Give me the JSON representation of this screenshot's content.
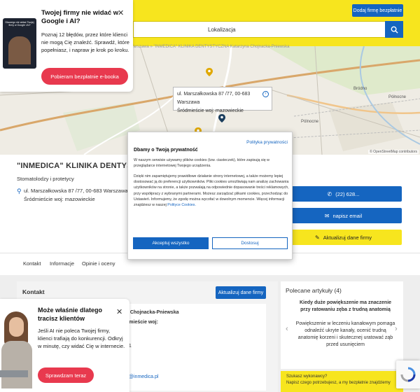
{
  "header": {
    "add_company_label": "Dodaj firmę bezpłatnie",
    "search_location_label": "Lokalizacja"
  },
  "map": {
    "breadcrumb": "» Warszawa » \"INMEDICA\" KLINIKA DENTYSTYCZNA Katarzyna Chojnacka-Pniewska",
    "popup_line1": "ul. Marszałkowska 87 /77, 00-683 Warszawa",
    "popup_line2": "Śródmieście woj: mazowieckie",
    "credit": "© OpenStreetMap contributors",
    "labels": [
      "Bródno",
      "Północne",
      "Pólnocne"
    ]
  },
  "company": {
    "name": "\"INMEDICA\" KLINIKA DENTYSTYCZN",
    "category": "Stomatolodzy i protetycy",
    "address_line1": "ul. Marszałkowska 87 /77, 00-683 Warszawa",
    "address_line2": "Śródmieście woj: mazowieckie",
    "phone_label": "(22) 628...",
    "email_label": "napisz email",
    "update_label": "Aktualizuj dane firmy"
  },
  "tabs": [
    "Kontakt",
    "Informacje",
    "Opinie i oceny"
  ],
  "contact": {
    "title": "Kontakt",
    "update_label": "Aktualizuj dane firmy",
    "line1": "a Chojnacka-Pniewska",
    "line2": "dmieście woj:",
    "line3": "01",
    "email_fragment": "a@inmedica.pl"
  },
  "recommended": {
    "title": "Polecane artykuły (4)",
    "headline": "Kiedy duże powiększenie ma znaczenie przy ratowaniu zęba z trudną anatomią",
    "body": "Powiększenie w leczeniu kanałowym pomaga odnaleźć ukryte kanały, ocenić trudną anatomię korzeni i skutecznej uratować ząb przed usunięciem",
    "yellow_line1": "Szukasz wykonawcy?",
    "yellow_line2": "Napisz czego potrzebujesz, a my bezpłatnie znajdziemy"
  },
  "promo_top": {
    "title": "Twojej firmy nie widać w Google i AI?",
    "body": "Poznaj 12 błędów, przez które klienci nie mogą Cię znaleźć. Sprawdź, które popełniasz, i napraw je krok po kroku.",
    "button": "Pobieram bezpłatnie e-booka",
    "ebook_cover_text": "Dlaczego nie widać Twojej firmy w Google i AI?"
  },
  "promo_bottom": {
    "title": "Może właśnie dlatego tracisz klientów",
    "body": "Jeśli AI nie poleca Twojej firmy, klienci trafiają do konkurencji. Odkryj w minutę, czy widać Cię w internecie.",
    "button": "Sprawdzam teraz"
  },
  "cookie": {
    "policy_link": "Polityka prywatności",
    "title": "Dbamy o Twoją prywatność",
    "p1": "W naszym serwisie używamy plików cookies (tzw. ciasteczek), które zapisują się w przeglądarce internetowej Twojego urządzenia.",
    "p2": "Dzięki nim zapamiętujemy prawidłowe działanie strony internetowej, a także możemy lepiej dostosować ją do preferencji użytkowników. Pliki cookies umożliwiają nam analizę zachowania użytkowników na stronie, a także pozwalają na odpowiednie dopasowanie treści reklamowych, przy współpracy z wybranymi partnerami. Możesz zarządzać plikami cookies, przechodząc do Ustawień. Informujemy, że zgodę można wycofać w dowolnym momencie. Więcej informacji znajdziesz w naszej",
    "p2_link": "Polityce Cookies.",
    "accept": "Akceptuj wszystko",
    "reject": "Dostosuj"
  },
  "colors": {
    "brand_yellow": "#f7e51e",
    "brand_blue": "#1565c0",
    "promo_red": "#e8394e"
  }
}
